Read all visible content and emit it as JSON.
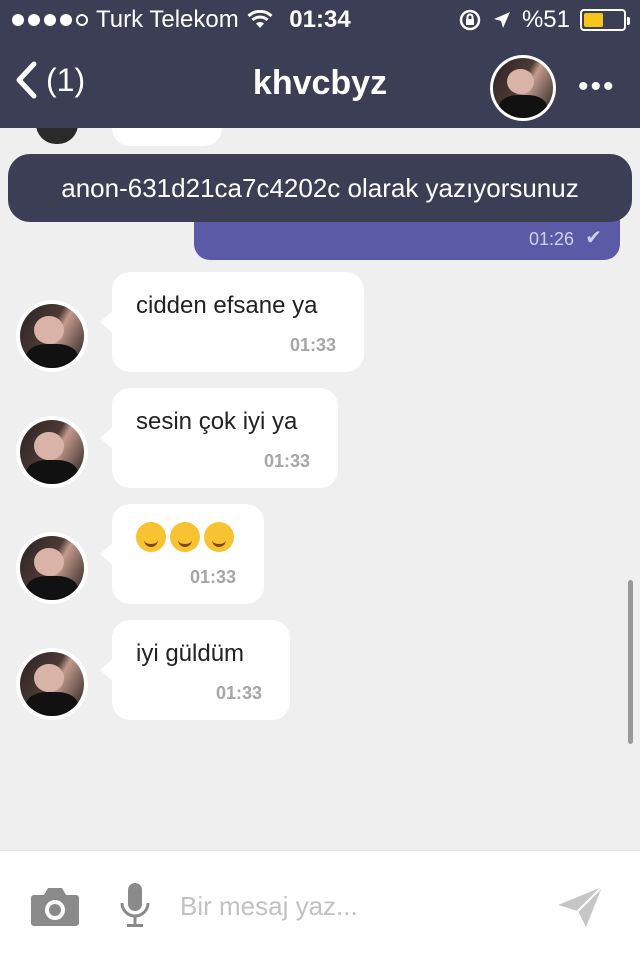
{
  "status_bar": {
    "carrier": "Turk Telekom",
    "time": "01:34",
    "battery_text": "%51",
    "battery_level": 0.51,
    "battery_color": "#f5c518",
    "signal_bars_filled": 4,
    "signal_bars_total": 5
  },
  "nav": {
    "back_label": "(1)",
    "title": "khvcbyz",
    "more_label": "•••"
  },
  "tooltip": {
    "text": "anon-631d21ca7c4202c olarak yazıyorsunuz"
  },
  "outgoing": {
    "time": "01:26",
    "check": "✔"
  },
  "messages": [
    {
      "text": "cidden efsane ya",
      "time": "01:33"
    },
    {
      "text": "sesin çok iyi ya",
      "time": "01:33"
    },
    {
      "text": "",
      "emojis": [
        "face-with-tears-of-joy",
        "smiling-face",
        "smiling-face"
      ],
      "time": "01:33"
    },
    {
      "text": "iyi güldüm",
      "time": "01:33"
    }
  ],
  "composer": {
    "placeholder": "Bir mesaj yaz..."
  },
  "colors": {
    "header": "#3b3e54",
    "outgoing_bubble": "#5a5aa6",
    "background": "#efefef"
  }
}
